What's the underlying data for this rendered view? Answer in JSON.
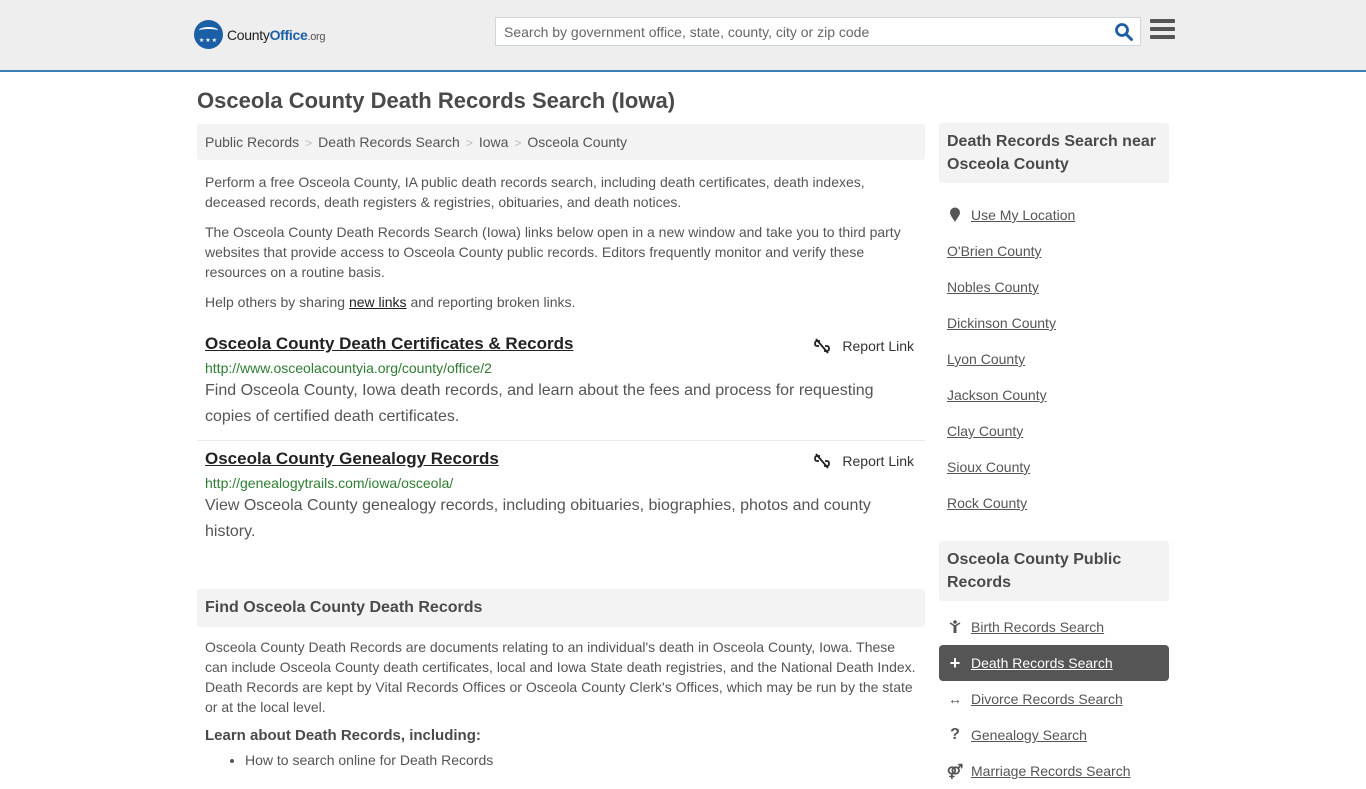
{
  "header": {
    "logo": {
      "part1": "County",
      "part2": "Office",
      "part3": ".org"
    },
    "search_placeholder": "Search by government office, state, county, city or zip code",
    "search_value": ""
  },
  "page_title": "Osceola County Death Records Search (Iowa)",
  "breadcrumb": [
    "Public Records",
    "Death Records Search",
    "Iowa",
    "Osceola County"
  ],
  "intro": {
    "p1": "Perform a free Osceola County, IA public death records search, including death certificates, death indexes, deceased records, death registers & registries, obituaries, and death notices.",
    "p2": "The Osceola County Death Records Search (Iowa) links below open in a new window and take you to third party websites that provide access to Osceola County public records. Editors frequently monitor and verify these resources on a routine basis.",
    "p3_before": "Help others by sharing ",
    "p3_link": "new links",
    "p3_after": " and reporting broken links."
  },
  "links": [
    {
      "title": "Osceola County Death Certificates & Records",
      "url": "http://www.osceolacountyia.org/county/office/2",
      "description": "Find Osceola County, Iowa death records, and learn about the fees and process for requesting copies of certified death certificates.",
      "report_label": "Report Link"
    },
    {
      "title": "Osceola County Genealogy Records",
      "url": "http://genealogytrails.com/iowa/osceola/",
      "description": "View Osceola County genealogy records, including obituaries, biographies, photos and county history.",
      "report_label": "Report Link"
    }
  ],
  "find_section": {
    "heading": "Find Osceola County Death Records",
    "body": "Osceola County Death Records are documents relating to an individual's death in Osceola County, Iowa. These can include Osceola County death certificates, local and Iowa State death registries, and the National Death Index. Death Records are kept by Vital Records Offices or Osceola County Clerk's Offices, which may be run by the state or at the local level.",
    "learn_heading": "Learn about Death Records, including:",
    "learn_items": [
      "How to search online for Death Records"
    ]
  },
  "sidebar": {
    "nearby_heading": "Death Records Search near Osceola County",
    "use_location": "Use My Location",
    "nearby": [
      "O'Brien County",
      "Nobles County",
      "Dickinson County",
      "Lyon County",
      "Jackson County",
      "Clay County",
      "Sioux County",
      "Rock County"
    ],
    "public_heading": "Osceola County Public Records",
    "public_records": [
      {
        "label": "Birth Records Search",
        "icon": "child-icon",
        "active": false
      },
      {
        "label": "Death Records Search",
        "icon": "plus-icon",
        "active": true
      },
      {
        "label": "Divorce Records Search",
        "icon": "arrows-horizontal-icon",
        "active": false
      },
      {
        "label": "Genealogy Search",
        "icon": "question-icon",
        "active": false
      },
      {
        "label": "Marriage Records Search",
        "icon": "marriage-icon",
        "active": false
      }
    ]
  },
  "colors": {
    "brand_blue": "#1b5fa6",
    "header_border": "#3a7eb5",
    "url_green": "#2e7d32",
    "active_item_bg": "#555555"
  }
}
